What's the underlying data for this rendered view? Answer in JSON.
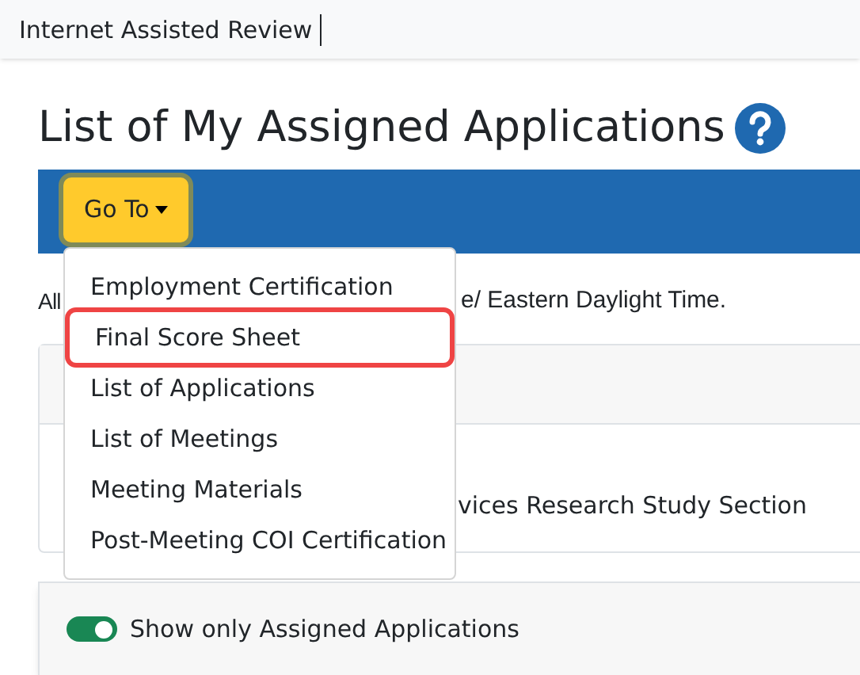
{
  "top_bar": {
    "title": "Internet Assisted Review"
  },
  "heading": {
    "title": "List of My Assigned Applications"
  },
  "toolbar": {
    "goto_button": "Go To"
  },
  "dropdown": {
    "items": [
      {
        "label": "Employment Certification",
        "highlighted": false
      },
      {
        "label": "Final Score Sheet",
        "highlighted": true
      },
      {
        "label": "List of Applications",
        "highlighted": false
      },
      {
        "label": "List of Meetings",
        "highlighted": false
      },
      {
        "label": "Meeting Materials",
        "highlighted": false
      },
      {
        "label": "Post-Meeting COI Certification",
        "highlighted": false
      }
    ]
  },
  "notice": {
    "text_start": "All",
    "text_end": "e/ Eastern Daylight Time."
  },
  "meeting_card": {
    "body_text": "vices Research Study Section"
  },
  "filter": {
    "toggle": {
      "label": "Show only Assigned Applications",
      "on": true
    }
  }
}
